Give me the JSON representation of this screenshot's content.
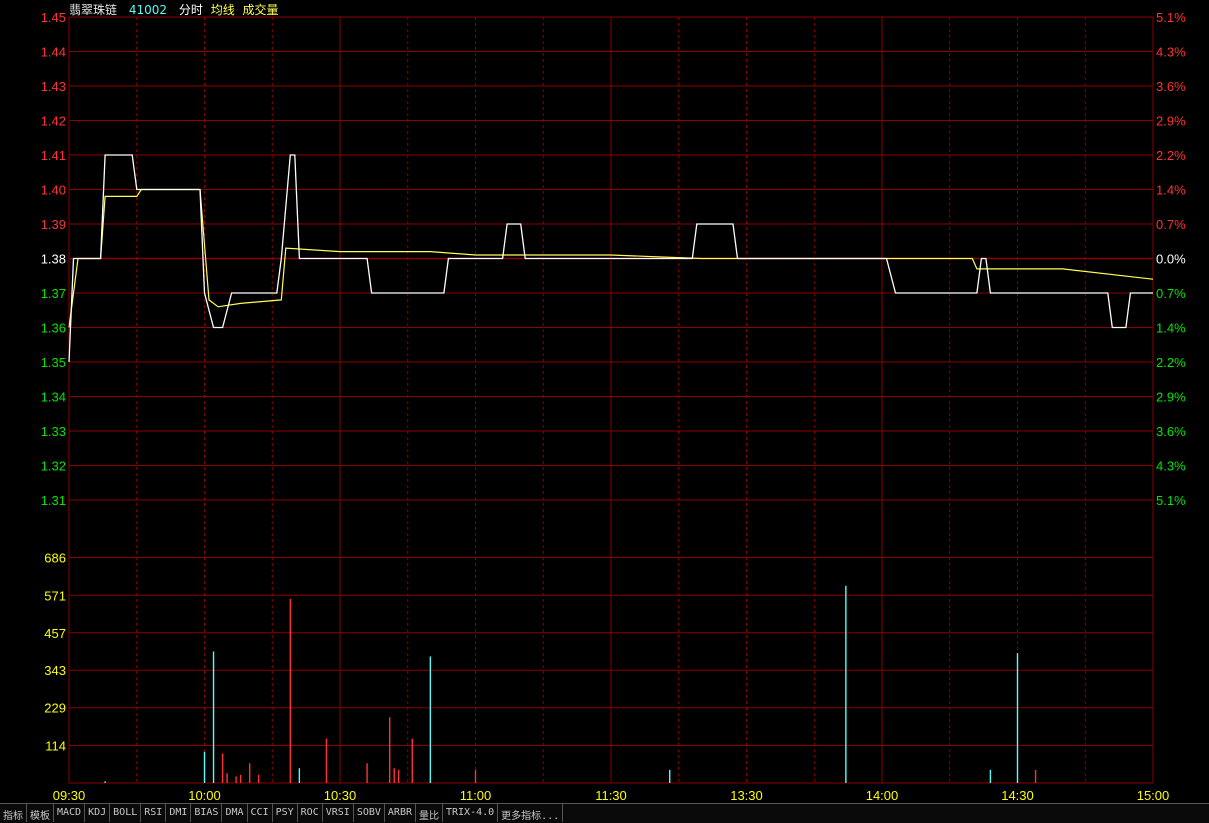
{
  "header": {
    "stock_name": "翡翠珠链",
    "stock_code": "41002",
    "legend_items": [
      "分时",
      "均线",
      "成交量"
    ]
  },
  "colors": {
    "background": "#000000",
    "grid": "#8b0000",
    "up": "#ff3232",
    "down": "#54fcfc",
    "price_line": "#ffffff",
    "avg_line": "#ffff54",
    "axis_text_red": "#ff3232",
    "axis_text_green": "#00e600",
    "axis_text_yellow": "#ffff00",
    "time_text": "#e0e0e0"
  },
  "tabs": [
    "指标",
    "模板",
    "MACD",
    "KDJ",
    "BOLL",
    "RSI",
    "DMI",
    "BIAS",
    "DMA",
    "CCI",
    "PSY",
    "ROC",
    "VRSI",
    "SOBV",
    "ARBR",
    "量比",
    "TRIX-4.0",
    "更多指标..."
  ],
  "chart_data": {
    "type": "line",
    "prev_close": 1.38,
    "price_ticks": [
      "1.45",
      "1.44",
      "1.43",
      "1.42",
      "1.41",
      "1.40",
      "1.39",
      "1.38",
      "1.37",
      "1.36",
      "1.35",
      "1.34",
      "1.33",
      "1.32",
      "1.31"
    ],
    "pct_ticks": [
      "5.1%",
      "4.3%",
      "3.6%",
      "2.9%",
      "2.2%",
      "1.4%",
      "0.7%",
      "0.0%",
      "0.7%",
      "1.4%",
      "2.2%",
      "2.9%",
      "3.6%",
      "4.3%",
      "5.1%"
    ],
    "ylim": [
      1.31,
      1.45
    ],
    "volume_ticks": [
      "686",
      "571",
      "457",
      "343",
      "229",
      "114"
    ],
    "volume_max": 800,
    "time_labels": [
      "09:30",
      "10:00",
      "10:30",
      "11:00",
      "11:30",
      "13:30",
      "14:00",
      "14:30",
      "15:00"
    ],
    "total_minutes": 240,
    "price_series": [
      [
        0,
        1.35
      ],
      [
        1,
        1.38
      ],
      [
        7,
        1.38
      ],
      [
        8,
        1.41
      ],
      [
        14,
        1.41
      ],
      [
        15,
        1.4
      ],
      [
        29,
        1.4
      ],
      [
        30,
        1.37
      ],
      [
        32,
        1.36
      ],
      [
        34,
        1.36
      ],
      [
        36,
        1.37
      ],
      [
        46,
        1.37
      ],
      [
        47,
        1.38
      ],
      [
        49,
        1.41
      ],
      [
        50,
        1.41
      ],
      [
        51,
        1.38
      ],
      [
        66,
        1.38
      ],
      [
        67,
        1.37
      ],
      [
        83,
        1.37
      ],
      [
        84,
        1.38
      ],
      [
        96,
        1.38
      ],
      [
        97,
        1.39
      ],
      [
        100,
        1.39
      ],
      [
        101,
        1.38
      ],
      [
        138,
        1.38
      ],
      [
        139,
        1.39
      ],
      [
        147,
        1.39
      ],
      [
        148,
        1.38
      ],
      [
        181,
        1.38
      ],
      [
        183,
        1.37
      ],
      [
        195,
        1.37
      ],
      [
        201,
        1.37
      ],
      [
        202,
        1.38
      ],
      [
        203,
        1.38
      ],
      [
        204,
        1.37
      ],
      [
        218,
        1.37
      ],
      [
        220,
        1.37
      ],
      [
        230,
        1.37
      ],
      [
        231,
        1.36
      ],
      [
        234,
        1.36
      ],
      [
        235,
        1.37
      ],
      [
        240,
        1.37
      ]
    ],
    "series": [
      {
        "values": "price_series"
      },
      {
        "values": "avg_series"
      }
    ],
    "avg_series": [
      [
        0,
        1.36
      ],
      [
        1,
        1.37
      ],
      [
        2,
        1.38
      ],
      [
        7,
        1.38
      ],
      [
        8,
        1.398
      ],
      [
        15,
        1.398
      ],
      [
        16,
        1.4
      ],
      [
        29,
        1.4
      ],
      [
        31,
        1.368
      ],
      [
        33,
        1.366
      ],
      [
        38,
        1.367
      ],
      [
        47,
        1.368
      ],
      [
        48,
        1.383
      ],
      [
        60,
        1.382
      ],
      [
        80,
        1.382
      ],
      [
        90,
        1.381
      ],
      [
        120,
        1.381
      ],
      [
        140,
        1.38
      ],
      [
        160,
        1.38
      ],
      [
        200,
        1.38
      ],
      [
        201,
        1.377
      ],
      [
        220,
        1.377
      ],
      [
        240,
        1.374
      ]
    ],
    "volume_bars": [
      {
        "t": 8,
        "v": 5,
        "dir": "down"
      },
      {
        "t": 30,
        "v": 95,
        "dir": "down"
      },
      {
        "t": 32,
        "v": 400,
        "dir": "down"
      },
      {
        "t": 34,
        "v": 90,
        "dir": "up"
      },
      {
        "t": 35,
        "v": 30,
        "dir": "up"
      },
      {
        "t": 37,
        "v": 20,
        "dir": "up"
      },
      {
        "t": 38,
        "v": 25,
        "dir": "up"
      },
      {
        "t": 40,
        "v": 60,
        "dir": "up"
      },
      {
        "t": 42,
        "v": 25,
        "dir": "up"
      },
      {
        "t": 49,
        "v": 560,
        "dir": "up"
      },
      {
        "t": 51,
        "v": 45,
        "dir": "down"
      },
      {
        "t": 57,
        "v": 135,
        "dir": "up"
      },
      {
        "t": 66,
        "v": 60,
        "dir": "up"
      },
      {
        "t": 71,
        "v": 200,
        "dir": "up"
      },
      {
        "t": 72,
        "v": 45,
        "dir": "up"
      },
      {
        "t": 73,
        "v": 40,
        "dir": "up"
      },
      {
        "t": 76,
        "v": 135,
        "dir": "up"
      },
      {
        "t": 80,
        "v": 385,
        "dir": "down"
      },
      {
        "t": 90,
        "v": 40,
        "dir": "up"
      },
      {
        "t": 133,
        "v": 40,
        "dir": "down"
      },
      {
        "t": 172,
        "v": 600,
        "dir": "down"
      },
      {
        "t": 204,
        "v": 40,
        "dir": "down"
      },
      {
        "t": 210,
        "v": 395,
        "dir": "down"
      },
      {
        "t": 214,
        "v": 40,
        "dir": "up"
      },
      {
        "t": 263,
        "v": 0,
        "dir": "up"
      }
    ]
  }
}
